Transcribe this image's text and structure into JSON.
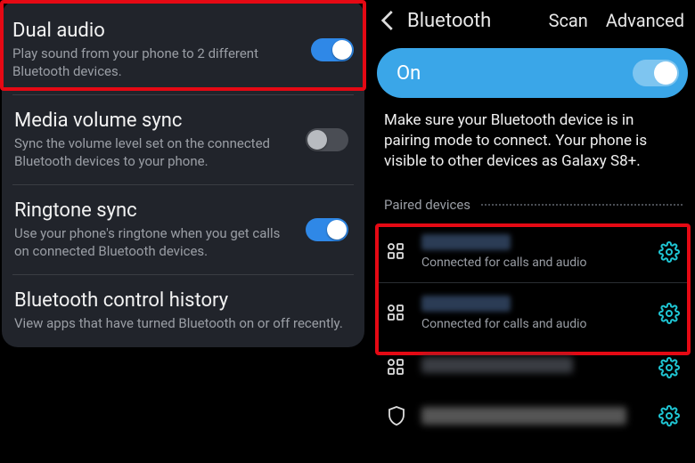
{
  "left": {
    "items": [
      {
        "title": "Dual audio",
        "sub": "Play sound from your phone to 2 different Bluetooth devices.",
        "toggle": "on"
      },
      {
        "title": "Media volume sync",
        "sub": "Sync the volume level set on the connected Bluetooth devices to your phone.",
        "toggle": "off"
      },
      {
        "title": "Ringtone sync",
        "sub": "Use your phone's ringtone when you get calls on connected Bluetooth devices.",
        "toggle": "on"
      },
      {
        "title": "Bluetooth control history",
        "sub": "View apps that have turned Bluetooth on or off recently.",
        "toggle": null
      }
    ]
  },
  "right": {
    "title": "Bluetooth",
    "actions": {
      "scan": "Scan",
      "advanced": "Advanced"
    },
    "on_label": "On",
    "help": "Make sure your Bluetooth device is in pairing mode to connect. Your phone is visible to other devices as Galaxy S8+.",
    "paired_label": "Paired devices",
    "devices": [
      {
        "sub": "Connected for calls and audio",
        "icon": "grid"
      },
      {
        "sub": "Connected for calls and audio",
        "icon": "grid"
      },
      {
        "sub": "",
        "icon": "grid"
      },
      {
        "sub": "",
        "icon": "shield"
      }
    ]
  }
}
